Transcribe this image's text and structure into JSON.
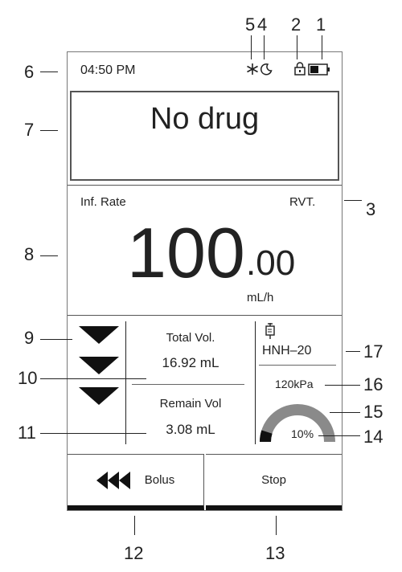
{
  "status_bar": {
    "time": "04:50 PM",
    "icons": [
      "snowflake-icon",
      "moon-icon",
      "lock-icon",
      "battery-icon"
    ]
  },
  "drug_panel": {
    "drug_name": "No drug"
  },
  "rate_panel": {
    "label": "Inf. Rate",
    "mode": "RVT.",
    "rate_integer": "100",
    "rate_decimal": ".00",
    "unit": "mL/h"
  },
  "volume_panel": {
    "total_label": "Total Vol.",
    "total_value": "16.92 mL",
    "remain_label": "Remain Vol",
    "remain_value": "3.08 mL"
  },
  "device_panel": {
    "device_icon": "syringe-icon",
    "model": "HNH–20",
    "pressure": "120kPa",
    "occlusion_percent": "10%",
    "occlusion_fraction": 0.1
  },
  "buttons": {
    "bolus_label": "Bolus",
    "stop_label": "Stop"
  },
  "callouts": {
    "n1": "1",
    "n2": "2",
    "n3": "3",
    "n4": "4",
    "n5": "5",
    "n6": "6",
    "n7": "7",
    "n8": "8",
    "n9": "9",
    "n10": "10",
    "n11": "11",
    "n12": "12",
    "n13": "13",
    "n14": "14",
    "n15": "15",
    "n16": "16",
    "n17": "17"
  },
  "colors": {
    "ink": "#111111",
    "frame": "#555555",
    "gauge": "#888888"
  }
}
